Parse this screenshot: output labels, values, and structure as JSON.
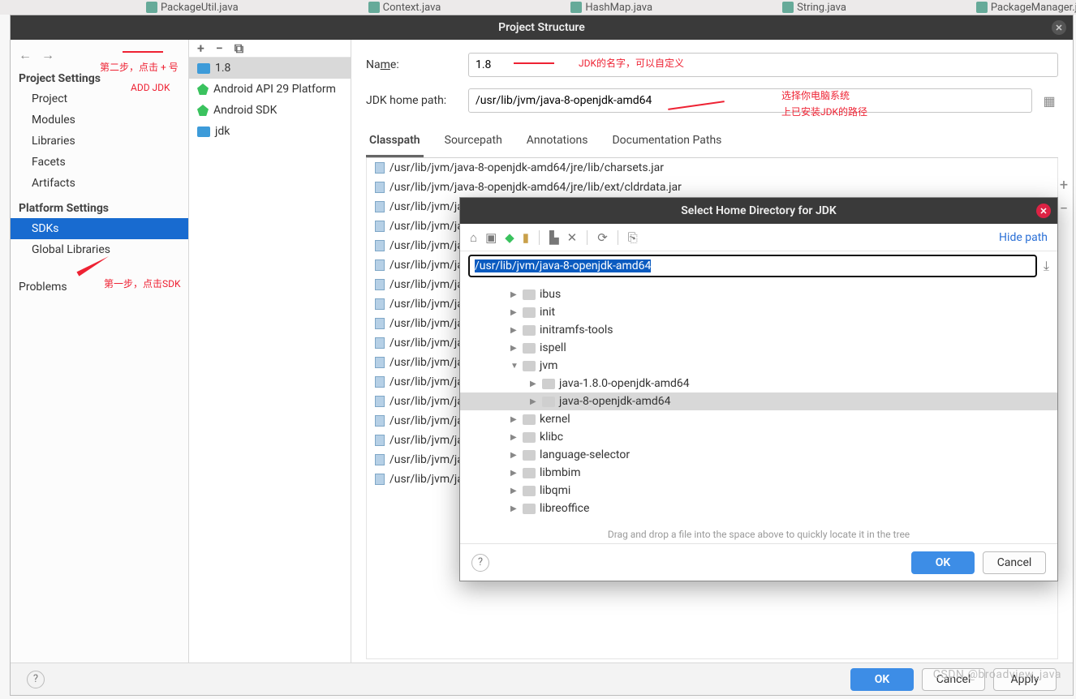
{
  "editor_tabs": [
    "PackageUtil.java",
    "Context.java",
    "HashMap.java",
    "String.java",
    "PackageManager.j"
  ],
  "window": {
    "title": "Project Structure"
  },
  "nav": {
    "back": "←",
    "fwd": "→",
    "sec1": "Project Settings",
    "items1": [
      "Project",
      "Modules",
      "Libraries",
      "Facets",
      "Artifacts"
    ],
    "sec2": "Platform Settings",
    "items2": [
      "SDKs",
      "Global Libraries"
    ],
    "problems": "Problems",
    "annot_step2": "第二步，点击 + 号",
    "annot_addjdk": "ADD JDK",
    "annot_step1": "第一步，点击SDK"
  },
  "toolbar": {
    "add": "+",
    "remove": "−",
    "copy": "⧉"
  },
  "sdks": [
    {
      "label": "1.8",
      "icon": "folder",
      "hl": true
    },
    {
      "label": "Android API 29 Platform",
      "icon": "android"
    },
    {
      "label": "Android SDK",
      "icon": "android"
    },
    {
      "label": "jdk",
      "icon": "folder"
    }
  ],
  "form": {
    "name_label": "Name:",
    "name_value": "1.8",
    "home_label": "JDK home path:",
    "home_value": "/usr/lib/jvm/java-8-openjdk-amd64",
    "annot_name": "JDK的名字，可以自定义",
    "annot_home1": "选择你电脑系统",
    "annot_home2": "上已安装JDK的路径"
  },
  "tabs": [
    "Classpath",
    "Sourcepath",
    "Annotations",
    "Documentation Paths"
  ],
  "classpath": [
    "/usr/lib/jvm/java-8-openjdk-amd64/jre/lib/charsets.jar",
    "/usr/lib/jvm/java-8-openjdk-amd64/jre/lib/ext/cldrdata.jar",
    "/usr/lib/jvm/java",
    "/usr/lib/jvm/java",
    "/usr/lib/jvm/java",
    "/usr/lib/jvm/java",
    "/usr/lib/jvm/java",
    "/usr/lib/jvm/java",
    "/usr/lib/jvm/java",
    "/usr/lib/jvm/java",
    "/usr/lib/jvm/java",
    "/usr/lib/jvm/java",
    "/usr/lib/jvm/java",
    "/usr/lib/jvm/java",
    "/usr/lib/jvm/java",
    "/usr/lib/jvm/java",
    "/usr/lib/jvm/java"
  ],
  "side": {
    "add": "+",
    "remove": "−"
  },
  "footer": {
    "ok": "OK",
    "cancel": "Cancel",
    "apply": "Apply"
  },
  "modal": {
    "title": "Select Home Directory for JDK",
    "hide": "Hide path",
    "path": "/usr/lib/jvm/java-8-openjdk-amd64",
    "tree": [
      {
        "lvl": 1,
        "expand": "▶",
        "label": "ibus"
      },
      {
        "lvl": 1,
        "expand": "▶",
        "label": "init"
      },
      {
        "lvl": 1,
        "expand": "▶",
        "label": "initramfs-tools"
      },
      {
        "lvl": 1,
        "expand": "▶",
        "label": "ispell"
      },
      {
        "lvl": 1,
        "expand": "▼",
        "label": "jvm"
      },
      {
        "lvl": 2,
        "expand": "▶",
        "label": "java-1.8.0-openjdk-amd64"
      },
      {
        "lvl": 2,
        "expand": "▶",
        "label": "java-8-openjdk-amd64",
        "sel": true
      },
      {
        "lvl": 1,
        "expand": "▶",
        "label": "kernel"
      },
      {
        "lvl": 1,
        "expand": "▶",
        "label": "klibc"
      },
      {
        "lvl": 1,
        "expand": "▶",
        "label": "language-selector"
      },
      {
        "lvl": 1,
        "expand": "▶",
        "label": "libmbim"
      },
      {
        "lvl": 1,
        "expand": "▶",
        "label": "libqmi"
      },
      {
        "lvl": 1,
        "expand": "▶",
        "label": "libreoffice"
      }
    ],
    "hint": "Drag and drop a file into the space above to quickly locate it in the tree",
    "ok": "OK",
    "cancel": "Cancel"
  },
  "watermark": "CSDN @broadview_java"
}
